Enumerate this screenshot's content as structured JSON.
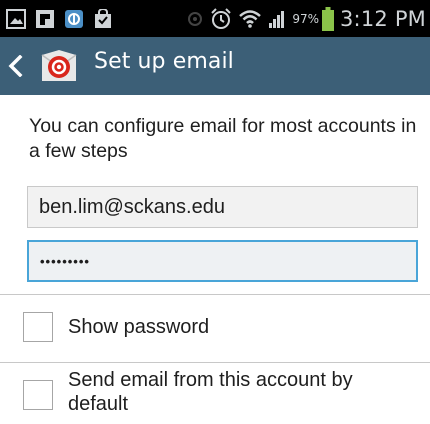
{
  "status_bar": {
    "battery_percent": "97%",
    "time": "3:12 PM",
    "left_icons": [
      "picture-notification-icon",
      "flipboard-icon",
      "app-notification-icon",
      "download-bag-icon"
    ],
    "right_icons": [
      "wifi-off-icon",
      "alarm-icon",
      "wifi-icon",
      "signal-icon",
      "battery-icon"
    ]
  },
  "action_bar": {
    "title": "Set up email",
    "back_icon": "chevron-left-icon",
    "app_icon": "email-app-icon",
    "background": "#3c5f77"
  },
  "intro_text": "You can configure email for most accounts in a few steps",
  "form": {
    "email_value": "ben.lim@sckans.edu",
    "password_masked": "•••••••••"
  },
  "options": {
    "show_password_label": "Show password",
    "show_password_checked": false,
    "default_account_label": "Send email from this account by default",
    "default_account_checked": false
  },
  "colors": {
    "focus_border": "#49a5d8"
  }
}
